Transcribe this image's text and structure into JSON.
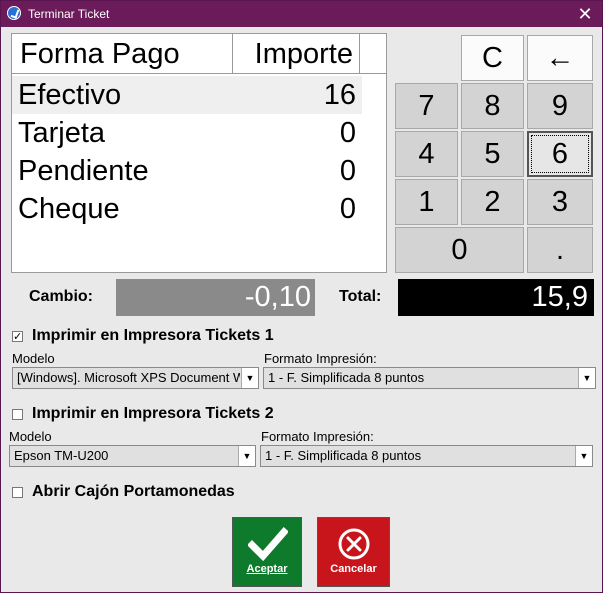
{
  "window": {
    "title": "Terminar Ticket",
    "close_glyph": "✕"
  },
  "table": {
    "headers": [
      "Forma Pago",
      "Importe"
    ],
    "rows": [
      {
        "label": "Efectivo",
        "value": "16"
      },
      {
        "label": "Tarjeta",
        "value": "0"
      },
      {
        "label": "Pendiente",
        "value": "0"
      },
      {
        "label": "Cheque",
        "value": "0"
      }
    ]
  },
  "keypad": {
    "clear": "C",
    "back": "←",
    "k7": "7",
    "k8": "8",
    "k9": "9",
    "k4": "4",
    "k5": "5",
    "k6": "6",
    "k1": "1",
    "k2": "2",
    "k3": "3",
    "k0": "0",
    "dot": "."
  },
  "summary": {
    "cambio_label": "Cambio:",
    "cambio_value": "-0,10",
    "total_label": "Total:",
    "total_value": "15,9"
  },
  "printer1": {
    "checked": true,
    "check_glyph": "✓",
    "label": "Imprimir en Impresora Tickets 1",
    "modelo_label": "Modelo",
    "modelo_value": "[Windows]. Microsoft XPS Document Writer",
    "formato_label": "Formato Impresión:",
    "formato_value": "1 - F. Simplificada 8 puntos"
  },
  "printer2": {
    "checked": false,
    "label": "Imprimir en Impresora Tickets 2",
    "modelo_label": "Modelo",
    "modelo_value": "Epson TM-U200",
    "formato_label": "Formato Impresión:",
    "formato_value": "1 - F. Simplificada 8 puntos"
  },
  "cajon": {
    "checked": false,
    "label": "Abrir Cajón Portamonedas"
  },
  "buttons": {
    "accept": "Aceptar",
    "cancel": "Cancelar"
  },
  "icons": {
    "accept": "check-icon",
    "cancel": "cancel-circle-icon",
    "dropdown": "▼"
  },
  "colors": {
    "titlebar": "#6b1a5a",
    "accept": "#0e7a2c",
    "cancel": "#c8151b"
  }
}
